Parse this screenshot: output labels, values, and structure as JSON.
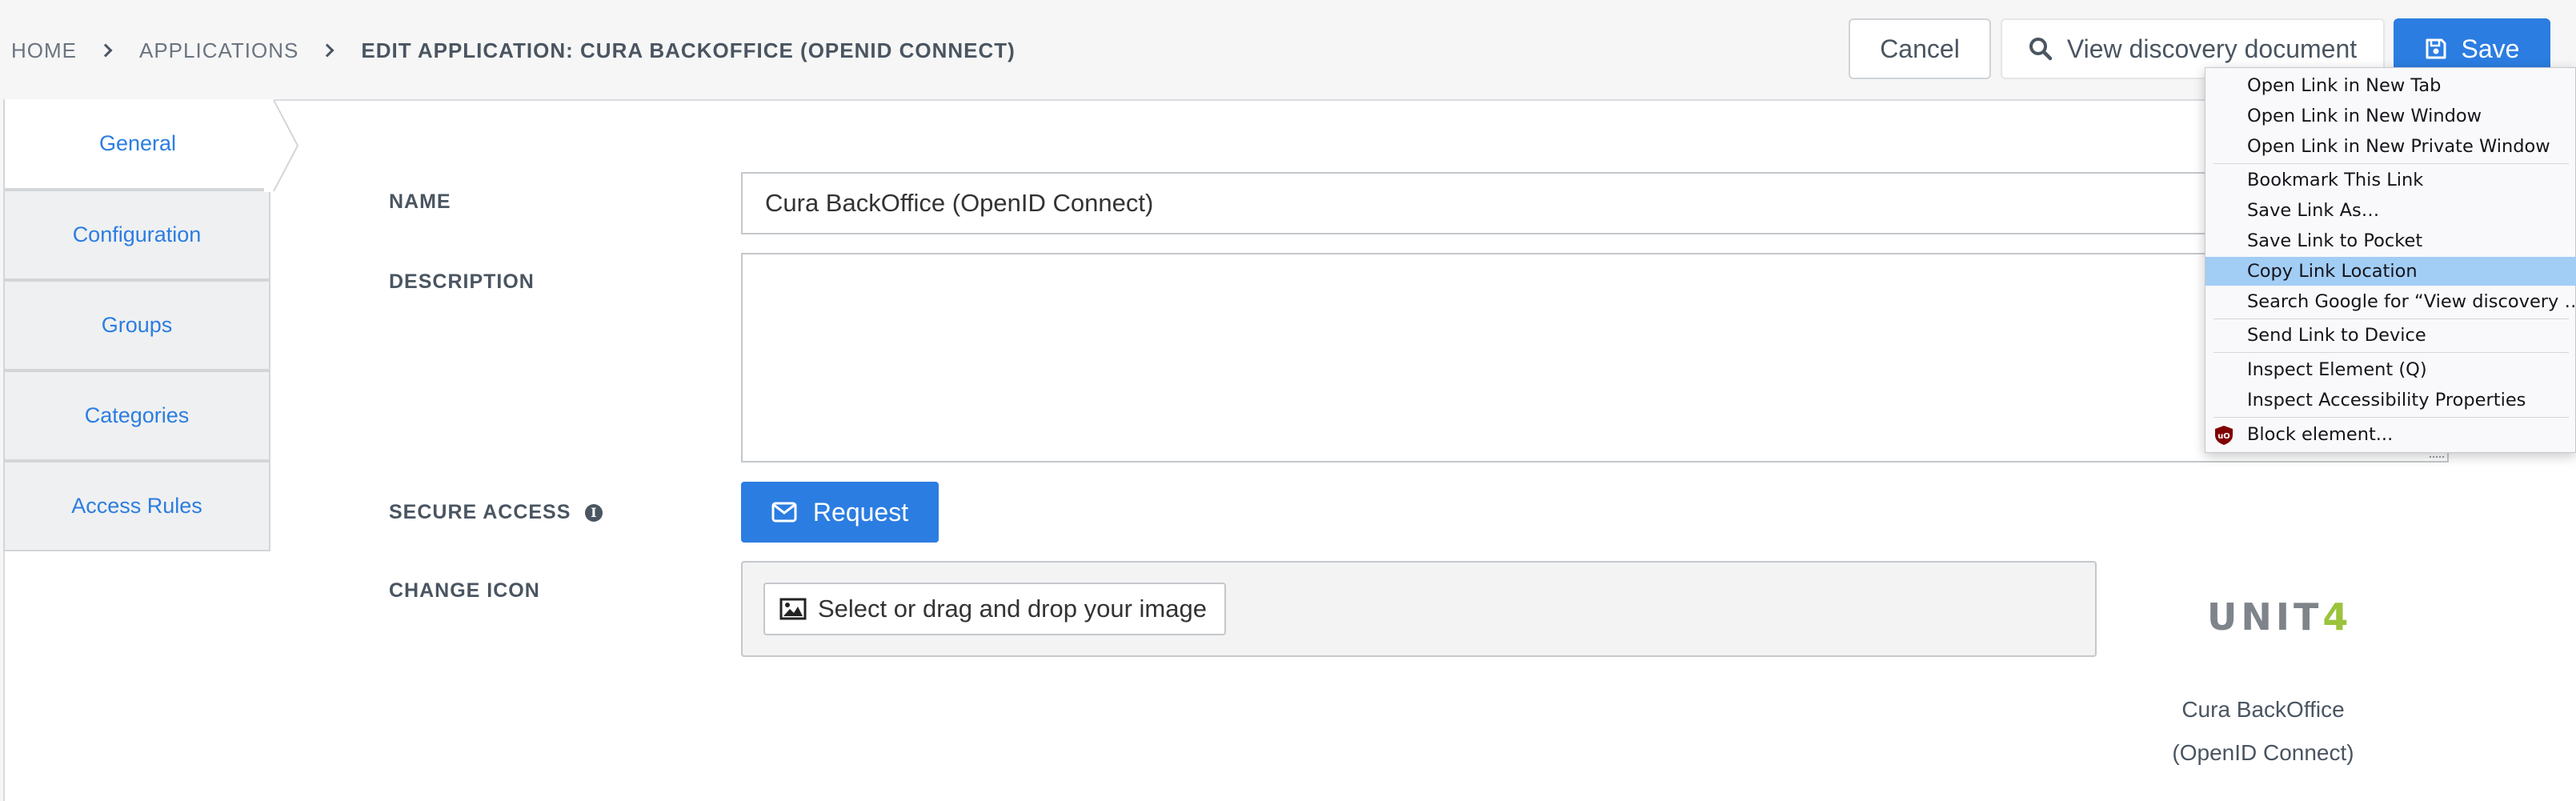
{
  "breadcrumb": {
    "home": "HOME",
    "applications": "APPLICATIONS",
    "current": "EDIT APPLICATION: CURA BACKOFFICE (OPENID CONNECT)"
  },
  "header": {
    "cancel_label": "Cancel",
    "discovery_label": "View discovery document",
    "save_label": "Save"
  },
  "tabs": [
    {
      "label": "General",
      "active": true
    },
    {
      "label": "Configuration",
      "active": false
    },
    {
      "label": "Groups",
      "active": false
    },
    {
      "label": "Categories",
      "active": false
    },
    {
      "label": "Access Rules",
      "active": false
    }
  ],
  "form": {
    "name_label": "NAME",
    "name_value": "Cura BackOffice (OpenID Connect)",
    "description_label": "DESCRIPTION",
    "description_value": "",
    "secure_access_label": "SECURE ACCESS",
    "request_label": "Request",
    "change_icon_label": "CHANGE ICON",
    "select_image_label": "Select or drag and drop your image"
  },
  "preview": {
    "logo_text": "UNIT",
    "logo_accent": "4",
    "caption_line1": "Cura BackOffice",
    "caption_line2": "(OpenID Connect)"
  },
  "context_menu": {
    "items": [
      "Open Link in New Tab",
      "Open Link in New Window",
      "Open Link in New Private Window",
      "Bookmark This Link",
      "Save Link As…",
      "Save Link to Pocket",
      "Copy Link Location",
      "Search Google for “View discovery …”",
      "Send Link to Device",
      "Inspect Element (Q)",
      "Inspect Accessibility Properties",
      "Block element..."
    ],
    "highlighted": "Copy Link Location"
  },
  "colors": {
    "accent": "#2b7de1",
    "menu_highlight": "#a2cdf5",
    "logo_accent": "#9bc33c"
  }
}
